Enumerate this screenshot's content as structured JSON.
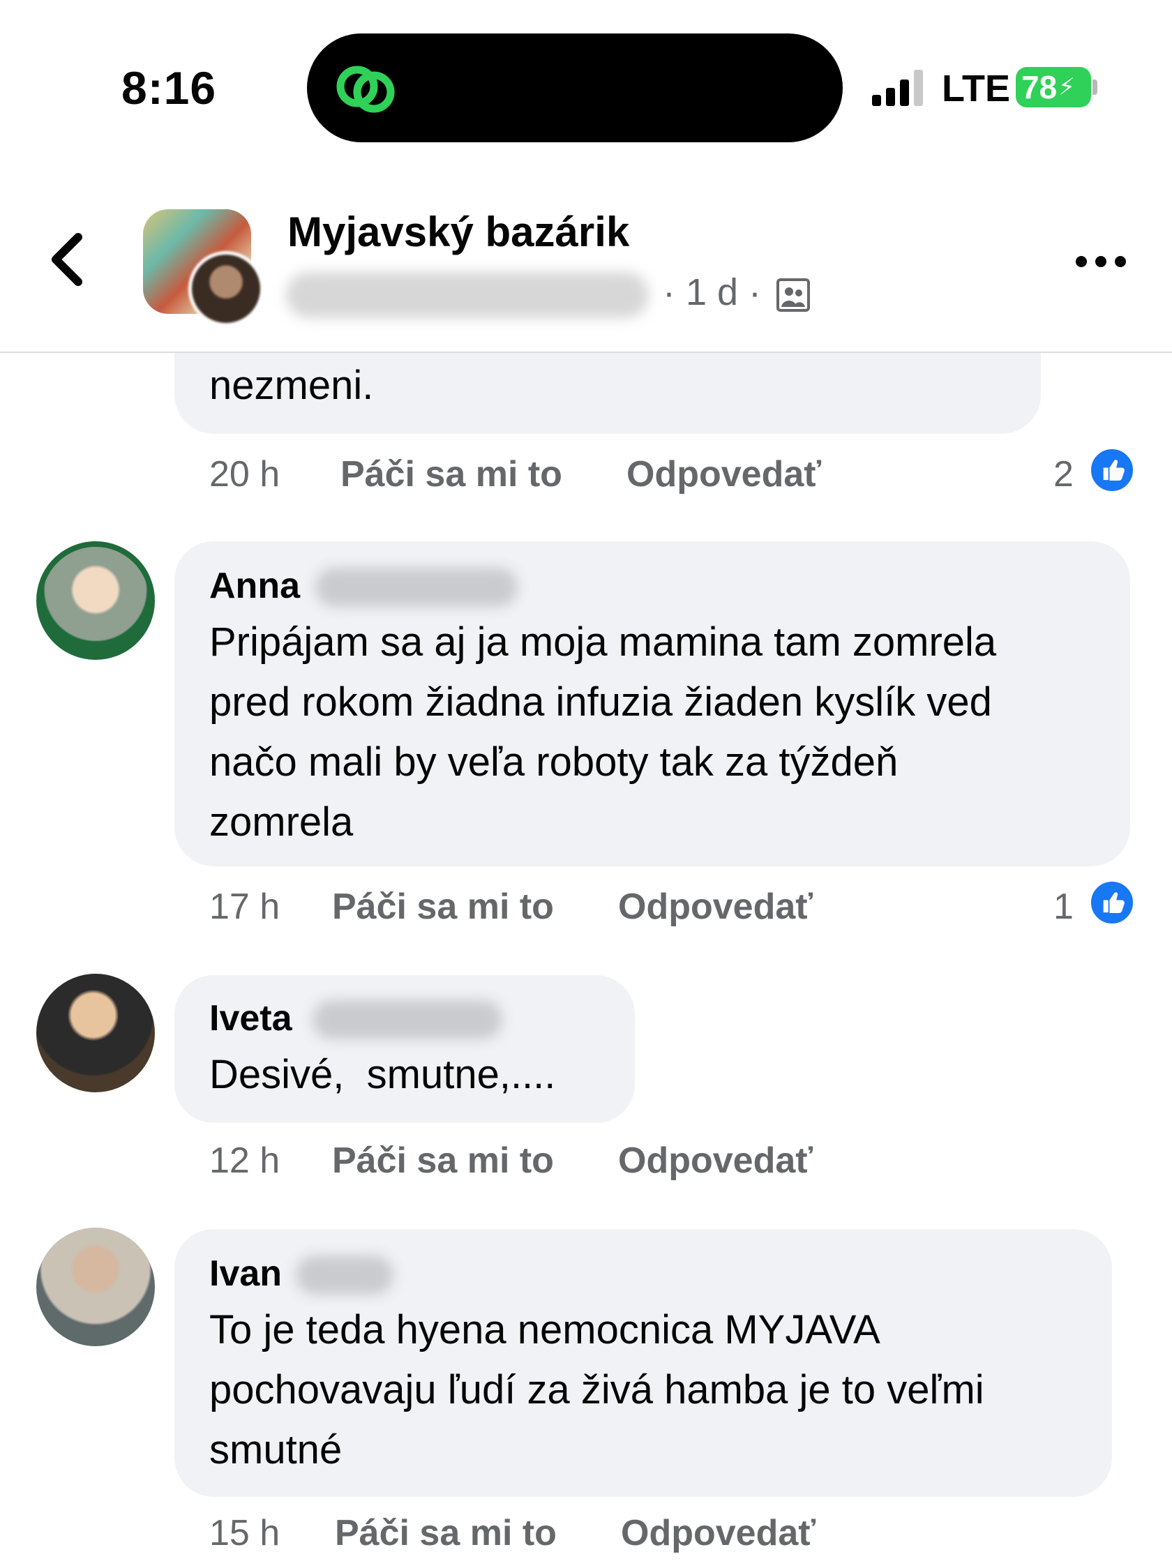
{
  "status_bar": {
    "time": "8:16",
    "network": "LTE",
    "battery": "78"
  },
  "header": {
    "group_name": "Myjavský bazárik",
    "post_meta": "· 1 d ·"
  },
  "previous_comment": {
    "text": "nezmeni.",
    "time": "20 h",
    "like_label": "Páči sa mi to",
    "reply_label": "Odpovedať",
    "reaction_count": "2"
  },
  "comments": [
    {
      "author": "Anna",
      "text": "Pripájam sa aj ja moja mamina tam zomrela\npred rokom žiadna infuzia žiaden kyslík ved\nnačo mali by veľa roboty tak za týždeň\nzomrela",
      "time": "17 h",
      "like_label": "Páči sa mi to",
      "reply_label": "Odpovedať",
      "reaction_count": "1"
    },
    {
      "author": "Iveta",
      "text": "Desivé,  smutne,....",
      "time": "12 h",
      "like_label": "Páči sa mi to",
      "reply_label": "Odpovedať"
    },
    {
      "author": "Ivan",
      "text": "To je teda hyena nemocnica MYJAVA\npochovavaju ľudí za živá hamba je to veľmi\nsmutné",
      "time": "15 h",
      "like_label": "Páči sa mi to",
      "reply_label": "Odpovedať"
    }
  ],
  "colors": {
    "bubble": "#f0f2f5",
    "secondary_text": "#65676b",
    "reaction_blue": "#1877f2",
    "battery_green": "#2fd158"
  },
  "icons": {
    "back": "chevron-left-icon",
    "more": "more-horizontal-icon",
    "privacy": "group-privacy-icon",
    "reaction": "thumbs-up-icon"
  }
}
